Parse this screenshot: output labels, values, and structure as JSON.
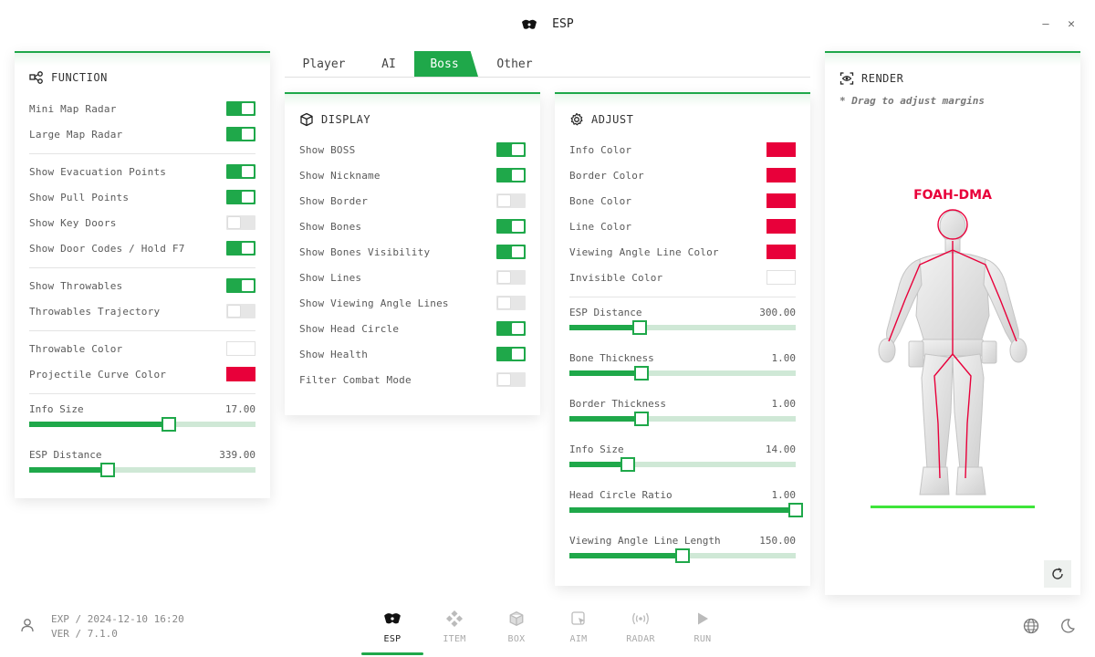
{
  "window": {
    "title": "ESP",
    "logo_icon": "mask-icon",
    "minimize_glyph": "—",
    "close_glyph": "✕"
  },
  "tabs": [
    {
      "label": "Player",
      "active": false
    },
    {
      "label": "AI",
      "active": false
    },
    {
      "label": "Boss",
      "active": true
    },
    {
      "label": "Other",
      "active": false
    }
  ],
  "function_panel": {
    "title": "FUNCTION",
    "icon": "nodes-icon",
    "toggles": [
      {
        "label": "Mini Map Radar",
        "on": true
      },
      {
        "label": "Large Map Radar",
        "on": true
      },
      {
        "label": "Show Evacuation Points",
        "on": true
      },
      {
        "label": "Show Pull Points",
        "on": true
      },
      {
        "label": "Show Key Doors",
        "on": false
      },
      {
        "label": "Show Door Codes / Hold F7",
        "on": true
      },
      {
        "label": "Show Throwables",
        "on": true
      },
      {
        "label": "Throwables Trajectory",
        "on": false
      }
    ],
    "colors": [
      {
        "label": "Throwable Color",
        "color": "#ffffff"
      },
      {
        "label": "Projectile Curve Color",
        "color": "#e8003a"
      }
    ],
    "sliders": [
      {
        "label": "Info Size",
        "value": "17.00",
        "fraction": 0.615
      },
      {
        "label": "ESP Distance",
        "value": "339.00",
        "fraction": 0.347
      }
    ]
  },
  "display_panel": {
    "title": "DISPLAY",
    "icon": "cube-icon",
    "toggles": [
      {
        "label": "Show BOSS",
        "on": true
      },
      {
        "label": "Show Nickname",
        "on": true
      },
      {
        "label": "Show Border",
        "on": false
      },
      {
        "label": "Show Bones",
        "on": true
      },
      {
        "label": "Show Bones Visibility",
        "on": true
      },
      {
        "label": "Show Lines",
        "on": false
      },
      {
        "label": "Show Viewing Angle Lines",
        "on": false
      },
      {
        "label": "Show Head Circle",
        "on": true
      },
      {
        "label": "Show Health",
        "on": true
      },
      {
        "label": "Filter Combat Mode",
        "on": false
      }
    ]
  },
  "adjust_panel": {
    "title": "ADJUST",
    "icon": "gear-icon",
    "colors": [
      {
        "label": "Info Color",
        "color": "#e8003a"
      },
      {
        "label": "Border Color",
        "color": "#e8003a"
      },
      {
        "label": "Bone Color",
        "color": "#e8003a"
      },
      {
        "label": "Line Color",
        "color": "#e8003a"
      },
      {
        "label": "Viewing Angle Line Color",
        "color": "#e8003a"
      },
      {
        "label": "Invisible Color",
        "color": "#ffffff"
      }
    ],
    "sliders": [
      {
        "label": "ESP Distance",
        "value": "300.00",
        "fraction": 0.31
      },
      {
        "label": "Bone Thickness",
        "value": "1.00",
        "fraction": 0.32
      },
      {
        "label": "Border Thickness",
        "value": "1.00",
        "fraction": 0.32
      },
      {
        "label": "Info Size",
        "value": "14.00",
        "fraction": 0.26
      },
      {
        "label": "Head Circle Ratio",
        "value": "1.00",
        "fraction": 1.0
      },
      {
        "label": "Viewing Angle Line Length",
        "value": "150.00",
        "fraction": 0.5
      }
    ]
  },
  "render_panel": {
    "title": "RENDER",
    "icon": "eye-target-icon",
    "note": "* Drag to adjust margins",
    "player_name": "FOAH-DMA",
    "reset_icon": "refresh-icon"
  },
  "footer": {
    "exp_text": "EXP / 2024-12-10 16:20",
    "ver_text": "VER / 7.1.0",
    "user_icon": "user-icon",
    "language_icon": "globe-icon",
    "theme_icon": "moon-icon"
  },
  "nav": [
    {
      "label": "ESP",
      "icon": "mask-icon",
      "active": true
    },
    {
      "label": "ITEM",
      "icon": "diamond-grid-icon",
      "active": false
    },
    {
      "label": "BOX",
      "icon": "box-icon",
      "active": false
    },
    {
      "label": "AIM",
      "icon": "cursor-icon",
      "active": false
    },
    {
      "label": "RADAR",
      "icon": "radar-icon",
      "active": false
    },
    {
      "label": "RUN",
      "icon": "play-icon",
      "active": false
    }
  ],
  "colors": {
    "accent": "#1fa84a",
    "accent_light": "#cfe8d6",
    "danger": "#e8003a",
    "ground_line": "#3ee53a"
  }
}
